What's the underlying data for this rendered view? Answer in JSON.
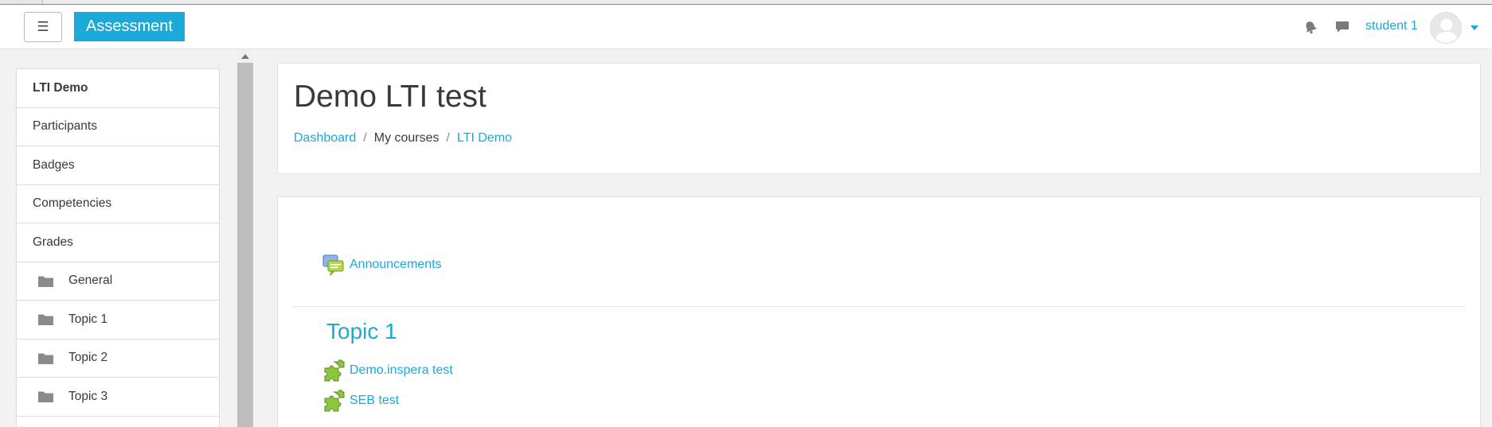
{
  "navbar": {
    "menu_label": "☰",
    "brand": "Assessment",
    "username": "student 1"
  },
  "drawer": {
    "items": [
      {
        "label": "LTI Demo"
      },
      {
        "label": "Participants"
      },
      {
        "label": "Badges"
      },
      {
        "label": "Competencies"
      },
      {
        "label": "Grades"
      },
      {
        "label": "General",
        "icon": "folder-icon"
      },
      {
        "label": "Topic 1",
        "icon": "folder-icon"
      },
      {
        "label": "Topic 2",
        "icon": "folder-icon"
      },
      {
        "label": "Topic 3",
        "icon": "folder-icon"
      }
    ]
  },
  "header": {
    "title": "Demo LTI test",
    "breadcrumb": [
      "Dashboard",
      "My courses",
      "LTI Demo"
    ],
    "separator": "/"
  },
  "content": {
    "announcements": "Announcements",
    "section_title": "Topic 1",
    "activities": [
      {
        "label": "Demo.inspera test",
        "icon": "puzzle-icon"
      },
      {
        "label": "SEB test",
        "icon": "puzzle-icon"
      }
    ]
  },
  "colors": {
    "accent": "#1aa9d8",
    "puzzle": "#8cc63f"
  }
}
